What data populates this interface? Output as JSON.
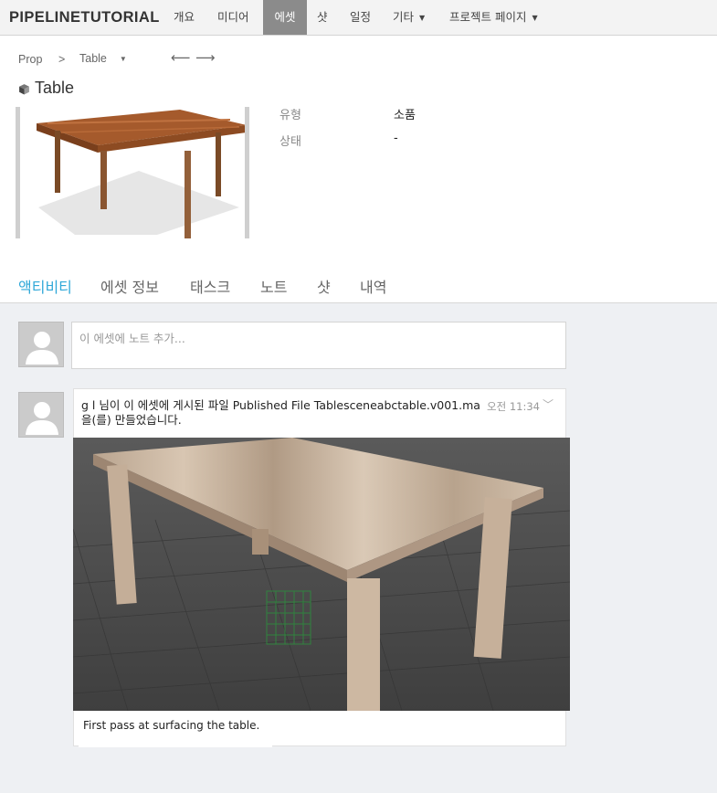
{
  "nav": {
    "brand": "PIPELINETUTORIAL",
    "items": [
      {
        "label": "개요"
      },
      {
        "label": "미디어"
      },
      {
        "label": "에셋"
      },
      {
        "label": "샷"
      },
      {
        "label": "일정"
      },
      {
        "label": "기타"
      },
      {
        "label": "프로젝트 페이지"
      }
    ],
    "active": "에셋"
  },
  "breadcrumb": {
    "type": "Prop",
    "separator": ">",
    "current": "Table",
    "prev_icon": "arrow-left-icon",
    "next_icon": "arrow-right-icon"
  },
  "asset": {
    "title": "Table",
    "icon": "cube-icon",
    "fields": [
      {
        "label": "유형",
        "value": "소품"
      },
      {
        "label": "상태",
        "value": "-"
      }
    ]
  },
  "tabs": [
    {
      "label": "액티비티",
      "active": true
    },
    {
      "label": "에셋 정보"
    },
    {
      "label": "태스크"
    },
    {
      "label": "노트"
    },
    {
      "label": "샷"
    },
    {
      "label": "내역"
    }
  ],
  "activity": {
    "note_placeholder": "이 에셋에 노트 추가...",
    "post": {
      "text": "g l 님이 이 에셋에 게시된 파일 Published File Tablesceneabctable.v001.ma 을(를) 만들었습니다.",
      "time_label": "오전",
      "time": "11:34",
      "caption": "First pass at surfacing the table."
    }
  },
  "colors": {
    "accent": "#30a8d8",
    "nav_active_bg": "#8b8b8b",
    "page_bg": "#eef0f3"
  }
}
